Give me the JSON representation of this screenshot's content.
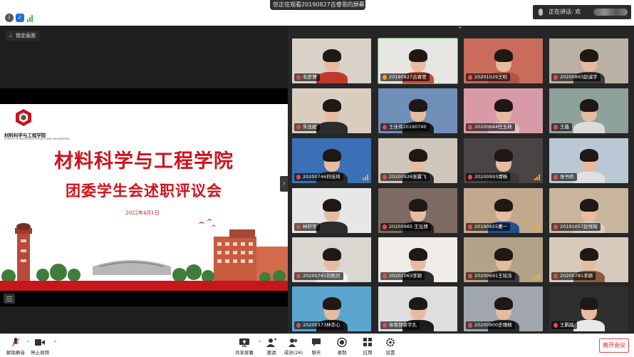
{
  "banner": {
    "share_text": "您正在观看20190827古睿思的屏幕",
    "more": "···"
  },
  "speaking": {
    "text": "正在讲话: 欢"
  },
  "left": {
    "lock_label": "锁定画面",
    "slide": {
      "logo_name": "材料科学与工程学院",
      "logo_english": "SCHOOL OF MATERIALS SCIENCE AND ENGINEERING",
      "title_line1": "材料科学与工程学院",
      "title_line2": "团委学生会述职评议会",
      "date": "2022年4月1日"
    }
  },
  "gallery": {
    "participants": [
      {
        "name": "毛彦博",
        "bg": "#d9d2c8",
        "shirt": "#c0392b",
        "mic": "off"
      },
      {
        "name": "20190827古睿思",
        "bg": "#e8e6e2",
        "shirt": "#c94c3a",
        "mic": "on"
      },
      {
        "name": "20201029王昭",
        "bg": "#c96c5b",
        "shirt": "#b35445",
        "mic": "off"
      },
      {
        "name": "20200893赵诚宇",
        "bg": "#b9b2a4",
        "shirt": "#3a3a3a",
        "mic": "off"
      },
      {
        "name": "朱显妮",
        "bg": "#d8cdbf",
        "shirt": "#2c2c2c",
        "mic": "off"
      },
      {
        "name": "王佳伟20190740",
        "bg": "#6f8fb8",
        "shirt": "#1c1c1c",
        "mic": "off"
      },
      {
        "name": "20200644任玉祥",
        "bg": "#d99aa8",
        "shirt": "#e4c0c6",
        "mic": "off"
      },
      {
        "name": "王鑫",
        "bg": "#8ea19b",
        "shirt": "#dcdcdc",
        "mic": "off"
      },
      {
        "name": "20200746何佳琦",
        "bg": "#3c70b6",
        "shirt": "#2b2b2b",
        "mic": "off"
      },
      {
        "name": "20200926张翼飞",
        "bg": "#cfc6bc",
        "shirt": "#2e2e2e",
        "mic": "off"
      },
      {
        "name": "20200993谭畅",
        "bg": "#4a4544",
        "shirt": "#3a3838",
        "mic": "off"
      },
      {
        "name": "张书桥",
        "bg": "#b9c8d4",
        "shirt": "#e0e0e0",
        "mic": "off"
      },
      {
        "name": "林轩宇",
        "bg": "#e7e7e7",
        "shirt": "#2d2d2d",
        "mic": "off"
      },
      {
        "name": "20200965 王泓博",
        "bg": "#7d6a62",
        "shirt": "#222",
        "mic": "off"
      },
      {
        "name": "20190655董一",
        "bg": "#c2a98e",
        "shirt": "#1f4f8a",
        "mic": "off"
      },
      {
        "name": "20191057赵悦琛",
        "bg": "#c9b59b",
        "shirt": "#d8d0c6",
        "mic": "off"
      },
      {
        "name": "20200745刘熙月",
        "bg": "#dad6d0",
        "shirt": "#f0f0f0",
        "mic": "off"
      },
      {
        "name": "20201063李颖",
        "bg": "#f0ece8",
        "shirt": "#2a2a2a",
        "mic": "off"
      },
      {
        "name": "20200691王铭浩",
        "bg": "#b4a288",
        "shirt": "#3a3a3a",
        "mic": "off"
      },
      {
        "name": "20200781李颖",
        "bg": "#d7cabc",
        "shirt": "#8a5a3a",
        "mic": "off"
      },
      {
        "name": "20200373林亦心",
        "bg": "#5aa6cf",
        "shirt": "#1c1c1c",
        "mic": "off"
      },
      {
        "name": "体育部蔡宇孔",
        "bg": "#dedede",
        "shirt": "#1c1c1c",
        "mic": "off"
      },
      {
        "name": "20200900史瑾楠",
        "bg": "#9fa7ad",
        "shirt": "#2a2a2a",
        "mic": "off"
      },
      {
        "name": "王鹏越",
        "bg": "#2f2f2f",
        "shirt": "#e8e8e8",
        "mic": "off"
      }
    ]
  },
  "toolbar": {
    "mute": "解除静音",
    "stop_video": "停止视频",
    "share": "共享屏幕",
    "invite": "邀请",
    "members": "成员(26)",
    "chat": "聊天",
    "record": "录制",
    "apps": "应用",
    "settings": "设置",
    "leave": "离开会议"
  },
  "colors": {
    "accent": "#d0121b",
    "leave": "#e02020",
    "speaking_bar": "#f2b21c"
  }
}
